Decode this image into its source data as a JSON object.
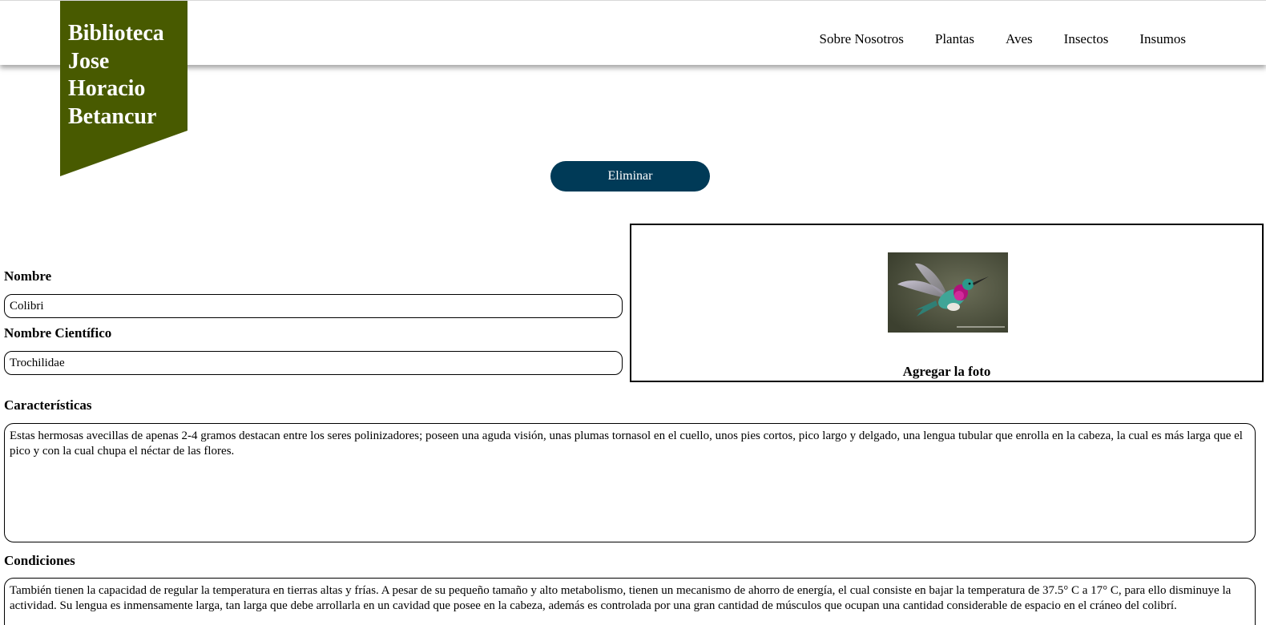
{
  "brand": {
    "lines": [
      "Biblioteca",
      "Jose",
      "Horacio",
      "Betancur"
    ],
    "color": "#485a00"
  },
  "nav": {
    "items": [
      "Sobre Nosotros",
      "Plantas",
      "Aves",
      "Insectos",
      "Insumos"
    ]
  },
  "actions": {
    "delete_label": "Eliminar",
    "delete_color": "#003a57"
  },
  "form": {
    "nombre_label": "Nombre",
    "nombre_value": "Colibri",
    "cientifico_label": "Nombre Científico",
    "cientifico_value": "Trochilidae",
    "caracteristicas_label": "Características",
    "caracteristicas_value": "Estas hermosas avecillas de apenas 2-4 gramos destacan entre los seres polinizadores; poseen una aguda visión, unas plumas tornasol en el cuello, unos pies cortos, pico largo y delgado, una lengua tubular que enrolla en la cabeza, la cual es más larga que el pico y con la cual chupa el néctar de las flores.",
    "condiciones_label": "Condiciones",
    "condiciones_value": "También tienen la capacidad de regular la temperatura en tierras altas y frías. A pesar de su pequeño tamaño y alto metabolismo, tienen un mecanismo de ahorro de energía, el cual consiste en bajar la temperatura de 37.5° C a 17° C, para ello disminuye la actividad. Su lengua es inmensamente larga, tan larga que debe arrollarla en un cavidad que posee en la cabeza, además es controlada por una gran cantidad de músculos que ocupan una cantidad considerable de espacio en el cráneo del colibrí."
  },
  "photo": {
    "caption": "Agregar la foto",
    "icon": "hummingbird-photo"
  }
}
